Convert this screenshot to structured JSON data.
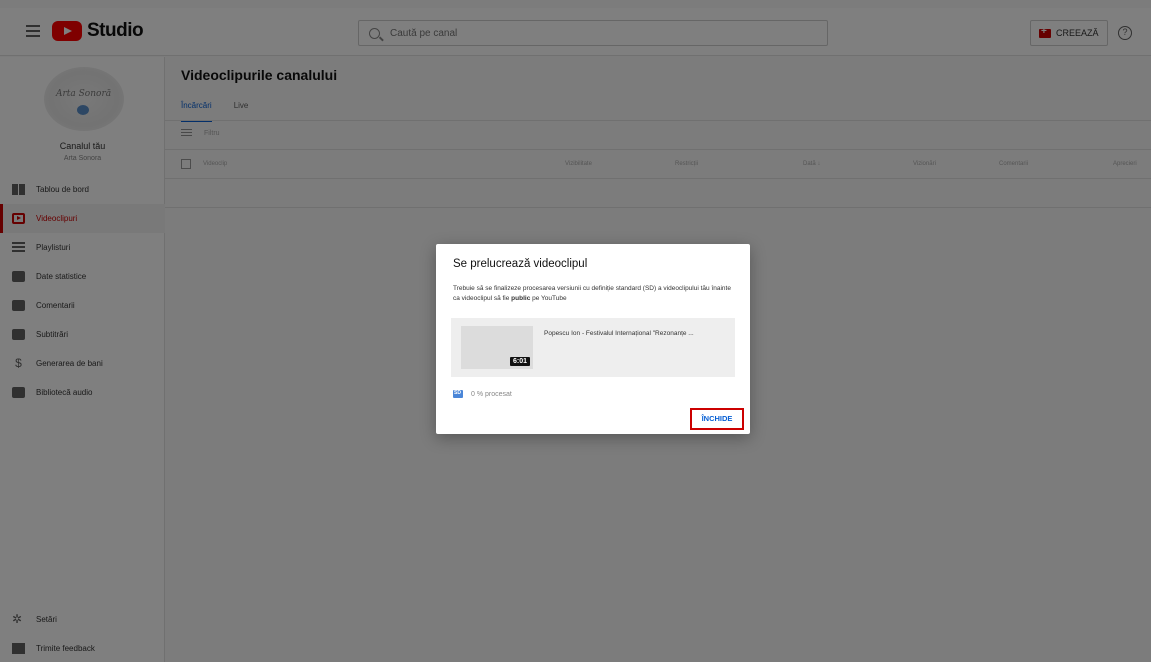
{
  "app": {
    "logo_text": "Studio"
  },
  "search": {
    "placeholder": "Caută pe canal"
  },
  "header": {
    "create_label": "CREEAZĂ",
    "help_glyph": "?"
  },
  "channel": {
    "avatar_text": "Arta Sonoră",
    "title": "Canalul tău",
    "subtitle": "Arta Sonora"
  },
  "sidebar": {
    "items": [
      {
        "label": "Tablou de bord",
        "icon": "dashboard-icon"
      },
      {
        "label": "Videoclipuri",
        "icon": "videos-icon",
        "active": true
      },
      {
        "label": "Playlisturi",
        "icon": "playlists-icon"
      },
      {
        "label": "Date statistice",
        "icon": "analytics-icon"
      },
      {
        "label": "Comentarii",
        "icon": "comments-icon"
      },
      {
        "label": "Subtitrări",
        "icon": "subtitles-icon"
      },
      {
        "label": "Generarea de bani",
        "icon": "dollar-icon"
      },
      {
        "label": "Bibliotecă audio",
        "icon": "audio-library-icon"
      }
    ],
    "bottom": [
      {
        "label": "Setări",
        "icon": "gear-icon"
      },
      {
        "label": "Trimite feedback",
        "icon": "feedback-icon"
      }
    ]
  },
  "main": {
    "title": "Videoclipurile canalului",
    "tabs": [
      {
        "label": "Încărcări",
        "active": true
      },
      {
        "label": "Live"
      }
    ],
    "filter_placeholder": "Filtru",
    "columns": [
      "Videoclip",
      "Vizibilitate",
      "Restricții",
      "Dată ↓",
      "Vizionări",
      "Comentarii",
      "Aprecieri"
    ]
  },
  "dialog": {
    "title": "Se prelucrează videoclipul",
    "desc_before": "Trebuie să se finalizeze procesarea versiunii cu definiție standard (SD) a videoclipului tău înainte ca videoclipul să fie ",
    "desc_bold": "public",
    "desc_after": " pe YouTube",
    "video_title": "Popescu Ion - Festivalul Internațional \"Rezonanțe ...",
    "duration": "6:01",
    "progress": "0 % procesat",
    "close_label": "ÎNCHIDE"
  },
  "colors": {
    "accent": "#065fd4",
    "brand": "#ff0000",
    "active": "#cc0000"
  }
}
